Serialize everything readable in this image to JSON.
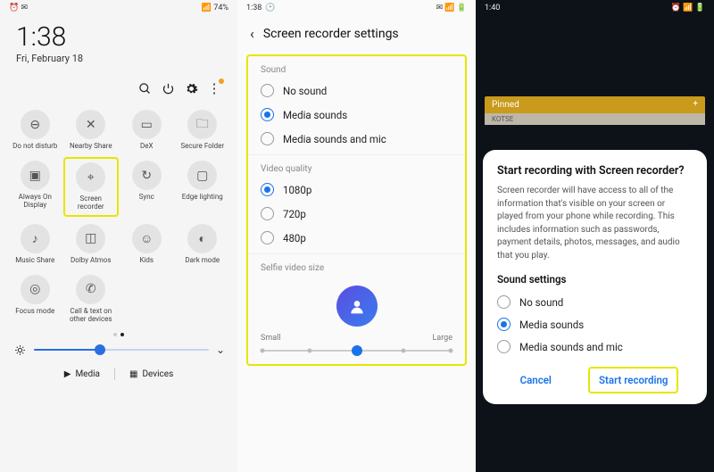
{
  "screen1": {
    "status": {
      "left": "",
      "icons": "⏰ ✉",
      "right": "📶 74%"
    },
    "clock": {
      "time": "1:38",
      "date": "Fri, February 18"
    },
    "tiles": [
      {
        "name": "do-not-disturb",
        "label": "Do not disturb",
        "glyph": "⊖"
      },
      {
        "name": "nearby-share",
        "label": "Nearby Share",
        "glyph": "✕"
      },
      {
        "name": "dex",
        "label": "DeX",
        "glyph": "▭"
      },
      {
        "name": "secure-folder",
        "label": "Secure Folder",
        "glyph": "🗀"
      },
      {
        "name": "always-on-display",
        "label": "Always On Display",
        "glyph": "▣"
      },
      {
        "name": "screen-recorder",
        "label": "Screen recorder",
        "glyph": "⌖",
        "highlight": true
      },
      {
        "name": "sync",
        "label": "Sync",
        "glyph": "↻"
      },
      {
        "name": "edge-lighting",
        "label": "Edge lighting",
        "glyph": "▢"
      },
      {
        "name": "music-share",
        "label": "Music Share",
        "glyph": "♪"
      },
      {
        "name": "dolby-atmos",
        "label": "Dolby Atmos",
        "glyph": "◫"
      },
      {
        "name": "kids",
        "label": "Kids",
        "glyph": "☺"
      },
      {
        "name": "dark-mode",
        "label": "Dark mode",
        "glyph": "◐"
      },
      {
        "name": "focus-mode",
        "label": "Focus mode",
        "glyph": "◎"
      },
      {
        "name": "call-text-devices",
        "label": "Call & text on other devices",
        "glyph": "✆"
      }
    ],
    "bottom": {
      "media": "Media",
      "devices": "Devices"
    }
  },
  "screen2": {
    "status_time": "1:38",
    "title": "Screen recorder settings",
    "sound": {
      "label": "Sound",
      "options": [
        "No sound",
        "Media sounds",
        "Media sounds and mic"
      ],
      "selected": 1
    },
    "video": {
      "label": "Video quality",
      "options": [
        "1080p",
        "720p",
        "480p"
      ],
      "selected": 0
    },
    "selfie": {
      "label": "Selfie video size",
      "small": "Small",
      "large": "Large"
    }
  },
  "screen3": {
    "status_time": "1:40",
    "pinned": "Pinned",
    "tag": "KOTSE",
    "dialog": {
      "title": "Start recording with Screen recorder?",
      "body": "Screen recorder will have access to all of the information that's visible on your screen or played from your phone while recording. This includes information such as passwords, payment details, photos, messages, and audio that you play.",
      "sound_label": "Sound settings",
      "options": [
        "No sound",
        "Media sounds",
        "Media sounds and mic"
      ],
      "selected": 1,
      "cancel": "Cancel",
      "start": "Start recording"
    }
  }
}
